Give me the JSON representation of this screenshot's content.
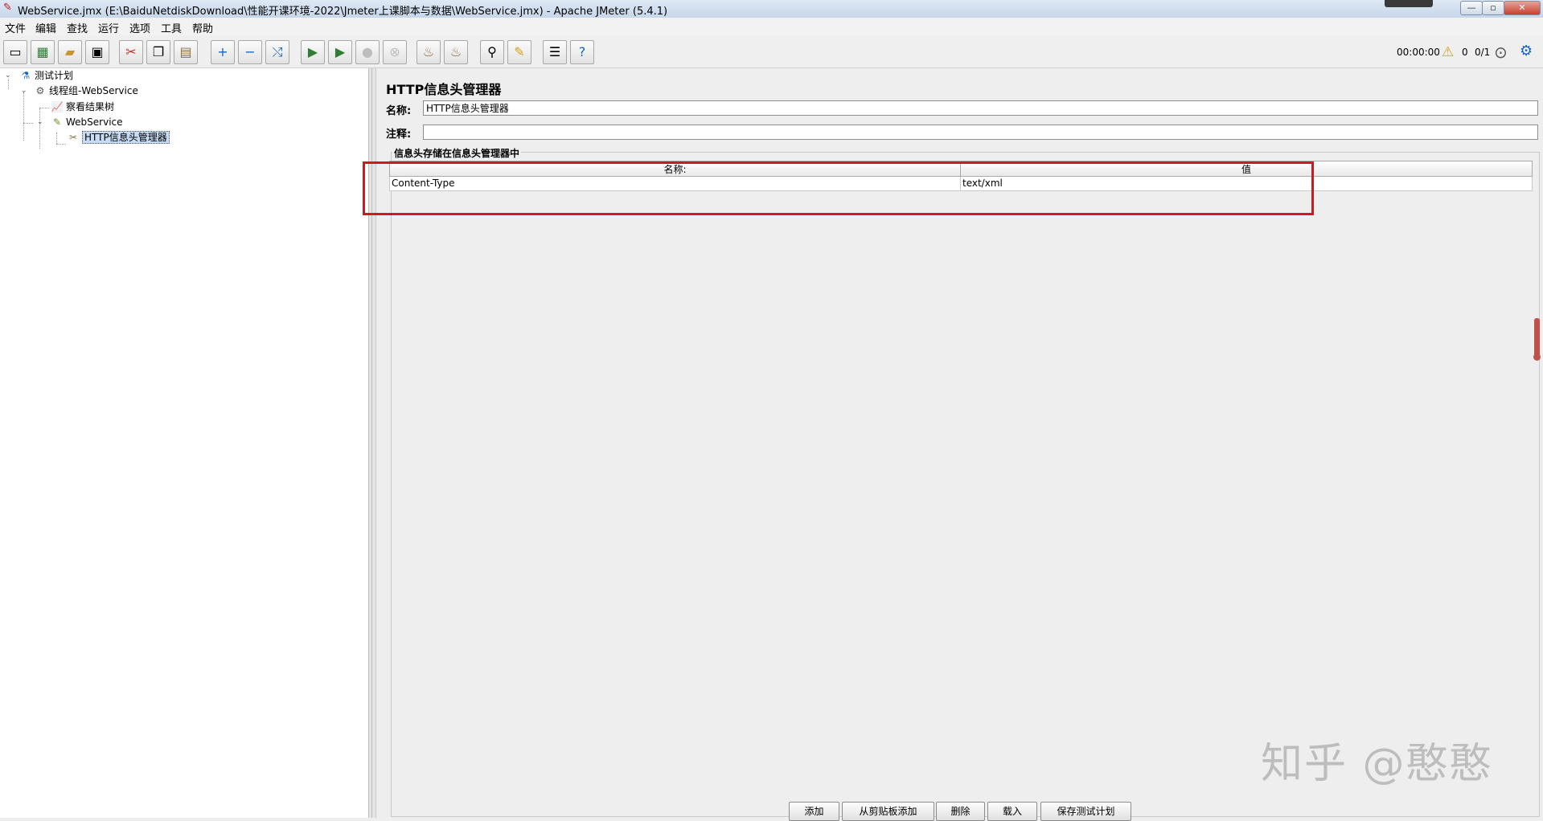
{
  "window": {
    "title": "WebService.jmx (E:\\BaiduNetdiskDownload\\性能开课环境-2022\\Jmeter上课脚本与数据\\WebService.jmx) - Apache JMeter (5.4.1)"
  },
  "menu": [
    "文件",
    "编辑",
    "查找",
    "运行",
    "选项",
    "工具",
    "帮助"
  ],
  "toolbar": {
    "icons": [
      "new-icon",
      "templates-icon",
      "open-icon",
      "save-icon",
      "cut-icon",
      "copy-icon",
      "paste-icon",
      "expand-icon",
      "collapse-icon",
      "toggle-icon",
      "start-icon",
      "start-no-pause-icon",
      "stop-icon",
      "shutdown-icon",
      "clear-icon",
      "clear-all-icon",
      "search-icon",
      "reset-search-icon",
      "function-helper-icon",
      "help-icon"
    ],
    "timer": "00:00:00",
    "warnings": "0",
    "threads": "0/1"
  },
  "tree": {
    "items": [
      {
        "label": "测试计划",
        "icon": "test-plan-icon"
      },
      {
        "label": "线程组-WebService",
        "icon": "thread-group-icon"
      },
      {
        "label": "察看结果树",
        "icon": "listener-icon"
      },
      {
        "label": "WebService",
        "icon": "sampler-icon"
      },
      {
        "label": "HTTP信息头管理器",
        "icon": "config-icon"
      }
    ]
  },
  "panel": {
    "title": "HTTP信息头管理器",
    "name_label": "名称:",
    "name_value": "HTTP信息头管理器",
    "comment_label": "注释:",
    "comment_value": "",
    "group_title": "信息头存储在信息头管理器中",
    "table": {
      "columns": [
        "名称:",
        "值"
      ],
      "rows": [
        {
          "name": "Content-Type",
          "value": "text/xml"
        }
      ]
    },
    "buttons": {
      "add": "添加",
      "add_clipboard": "从剪贴板添加",
      "delete": "删除",
      "load": "载入",
      "save_plan": "保存测试计划"
    }
  },
  "watermark": "知乎 @憨憨"
}
